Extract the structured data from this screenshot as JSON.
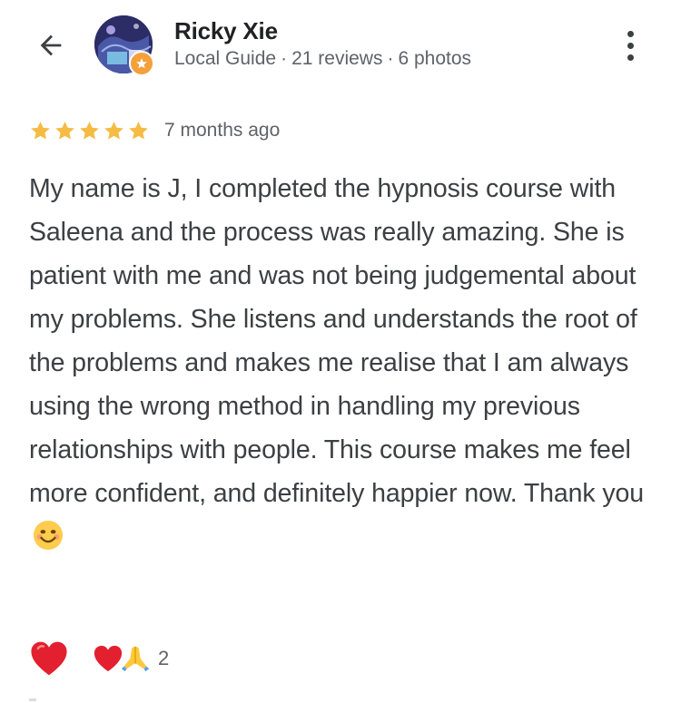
{
  "reviewer": {
    "name": "Ricky Xie",
    "badge": "Local Guide",
    "reviews": "21 reviews",
    "photos": "6 photos",
    "separator": "·"
  },
  "rating": {
    "stars": 5,
    "max": 5,
    "time": "7 months ago",
    "star_color": "#f6bb42"
  },
  "review": {
    "text": "My name is J, I completed the hypnosis course with Saleena and the process was really amazing. She is patient with me and was not being judgemental about my problems. She listens and understands the root of the problems and makes me realise that I am always using the wrong method in handling my previous relationships with people. This course makes me feel more confident, and definitely happier now. Thank you",
    "emoji": "smiling-face-icon"
  },
  "reactions": {
    "primary": "heart-icon",
    "group": [
      "heart-icon",
      "folded-hands-icon"
    ],
    "count": "2"
  },
  "icons": {
    "back": "back-arrow-icon",
    "more": "more-vert-icon"
  },
  "colors": {
    "heart": "#e2202f",
    "text": "#3c4043",
    "secondary": "#5f6368",
    "badge": "#f4a03b"
  }
}
